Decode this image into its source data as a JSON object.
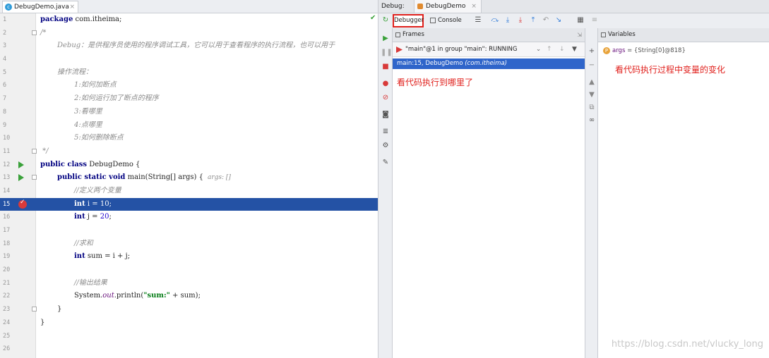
{
  "editor": {
    "tab_label": "DebugDemo.java",
    "tab_close": "×",
    "lines": [
      {
        "n": "1",
        "parts": [
          {
            "t": "package",
            "c": "kw"
          },
          {
            "t": " com.itheima;",
            "c": ""
          }
        ]
      },
      {
        "n": "2",
        "parts": [
          {
            "t": "/*",
            "c": "cm"
          }
        ]
      },
      {
        "n": "3",
        "indent": 1,
        "parts": [
          {
            "t": "Debug：是供程序员使用的程序调试工具，它可以用于查看程序的执行流程，也可以用于",
            "c": "cm"
          }
        ]
      },
      {
        "n": "4",
        "parts": []
      },
      {
        "n": "5",
        "indent": 1,
        "parts": [
          {
            "t": "操作流程：",
            "c": "cm"
          }
        ]
      },
      {
        "n": "6",
        "indent": 2,
        "parts": [
          {
            "t": "1:如何加断点",
            "c": "cm"
          }
        ]
      },
      {
        "n": "7",
        "indent": 2,
        "parts": [
          {
            "t": "2:如何运行加了断点的程序",
            "c": "cm"
          }
        ]
      },
      {
        "n": "8",
        "indent": 2,
        "parts": [
          {
            "t": "3:看哪里",
            "c": "cm"
          }
        ]
      },
      {
        "n": "9",
        "indent": 2,
        "parts": [
          {
            "t": "4:点哪里",
            "c": "cm"
          }
        ]
      },
      {
        "n": "10",
        "indent": 2,
        "parts": [
          {
            "t": "5:如何删除断点",
            "c": "cm"
          }
        ]
      },
      {
        "n": "11",
        "parts": [
          {
            "t": " */",
            "c": "cm"
          }
        ]
      },
      {
        "n": "12",
        "parts": [
          {
            "t": "public class",
            "c": "kw"
          },
          {
            "t": " DebugDemo {",
            "c": ""
          }
        ],
        "gutter": "run"
      },
      {
        "n": "13",
        "indent": 1,
        "parts": [
          {
            "t": "public static void",
            "c": "kw"
          },
          {
            "t": " main(String[] args) {",
            "c": ""
          },
          {
            "t": "args: []",
            "c": "hint"
          }
        ],
        "gutter": "run"
      },
      {
        "n": "14",
        "indent": 2,
        "parts": [
          {
            "t": "//定义两个变量",
            "c": "cm"
          }
        ]
      },
      {
        "n": "15",
        "indent": 2,
        "parts": [
          {
            "t": "int",
            "c": "kw"
          },
          {
            "t": " i = ",
            "c": ""
          },
          {
            "t": "10",
            "c": "num-lit"
          },
          {
            "t": ";",
            "c": ""
          }
        ],
        "gutter": "bp",
        "highlight": true
      },
      {
        "n": "16",
        "indent": 2,
        "parts": [
          {
            "t": "int",
            "c": "kw"
          },
          {
            "t": " j = ",
            "c": ""
          },
          {
            "t": "20",
            "c": "num-lit"
          },
          {
            "t": ";",
            "c": ""
          }
        ]
      },
      {
        "n": "17",
        "parts": []
      },
      {
        "n": "18",
        "indent": 2,
        "parts": [
          {
            "t": "//求和",
            "c": "cm"
          }
        ]
      },
      {
        "n": "19",
        "indent": 2,
        "parts": [
          {
            "t": "int",
            "c": "kw"
          },
          {
            "t": " sum = i + j;",
            "c": ""
          }
        ]
      },
      {
        "n": "20",
        "parts": []
      },
      {
        "n": "21",
        "indent": 2,
        "parts": [
          {
            "t": "//输出结果",
            "c": "cm"
          }
        ]
      },
      {
        "n": "22",
        "indent": 2,
        "parts": [
          {
            "t": "System.",
            "c": ""
          },
          {
            "t": "out",
            "c": "fld"
          },
          {
            "t": ".println(",
            "c": ""
          },
          {
            "t": "\"sum:\"",
            "c": "str"
          },
          {
            "t": " + sum);",
            "c": ""
          }
        ]
      },
      {
        "n": "23",
        "indent": 1,
        "parts": [
          {
            "t": "}",
            "c": ""
          }
        ]
      },
      {
        "n": "24",
        "parts": [
          {
            "t": "}",
            "c": ""
          }
        ]
      },
      {
        "n": "25",
        "parts": []
      },
      {
        "n": "26",
        "parts": []
      }
    ]
  },
  "debug": {
    "label": "Debug:",
    "session": "DebugDemo",
    "session_close": "×",
    "tabs": {
      "debugger": "Debugger",
      "console": "Console"
    },
    "frames": {
      "title": "Frames",
      "thread": "\"main\"@1 in group \"main\": RUNNING",
      "frame_method": "main:15, DebugDemo",
      "frame_pkg": "(com.itheima)"
    },
    "variables": {
      "title": "Variables",
      "items": [
        {
          "name": "args",
          "value": "= {String[0]@818}"
        }
      ]
    },
    "notes": {
      "frames_note": "看代码执行到哪里了",
      "vars_note": "看代码执行过程中变量的变化"
    }
  },
  "watermark": "https://blog.csdn.net/vlucky_long"
}
